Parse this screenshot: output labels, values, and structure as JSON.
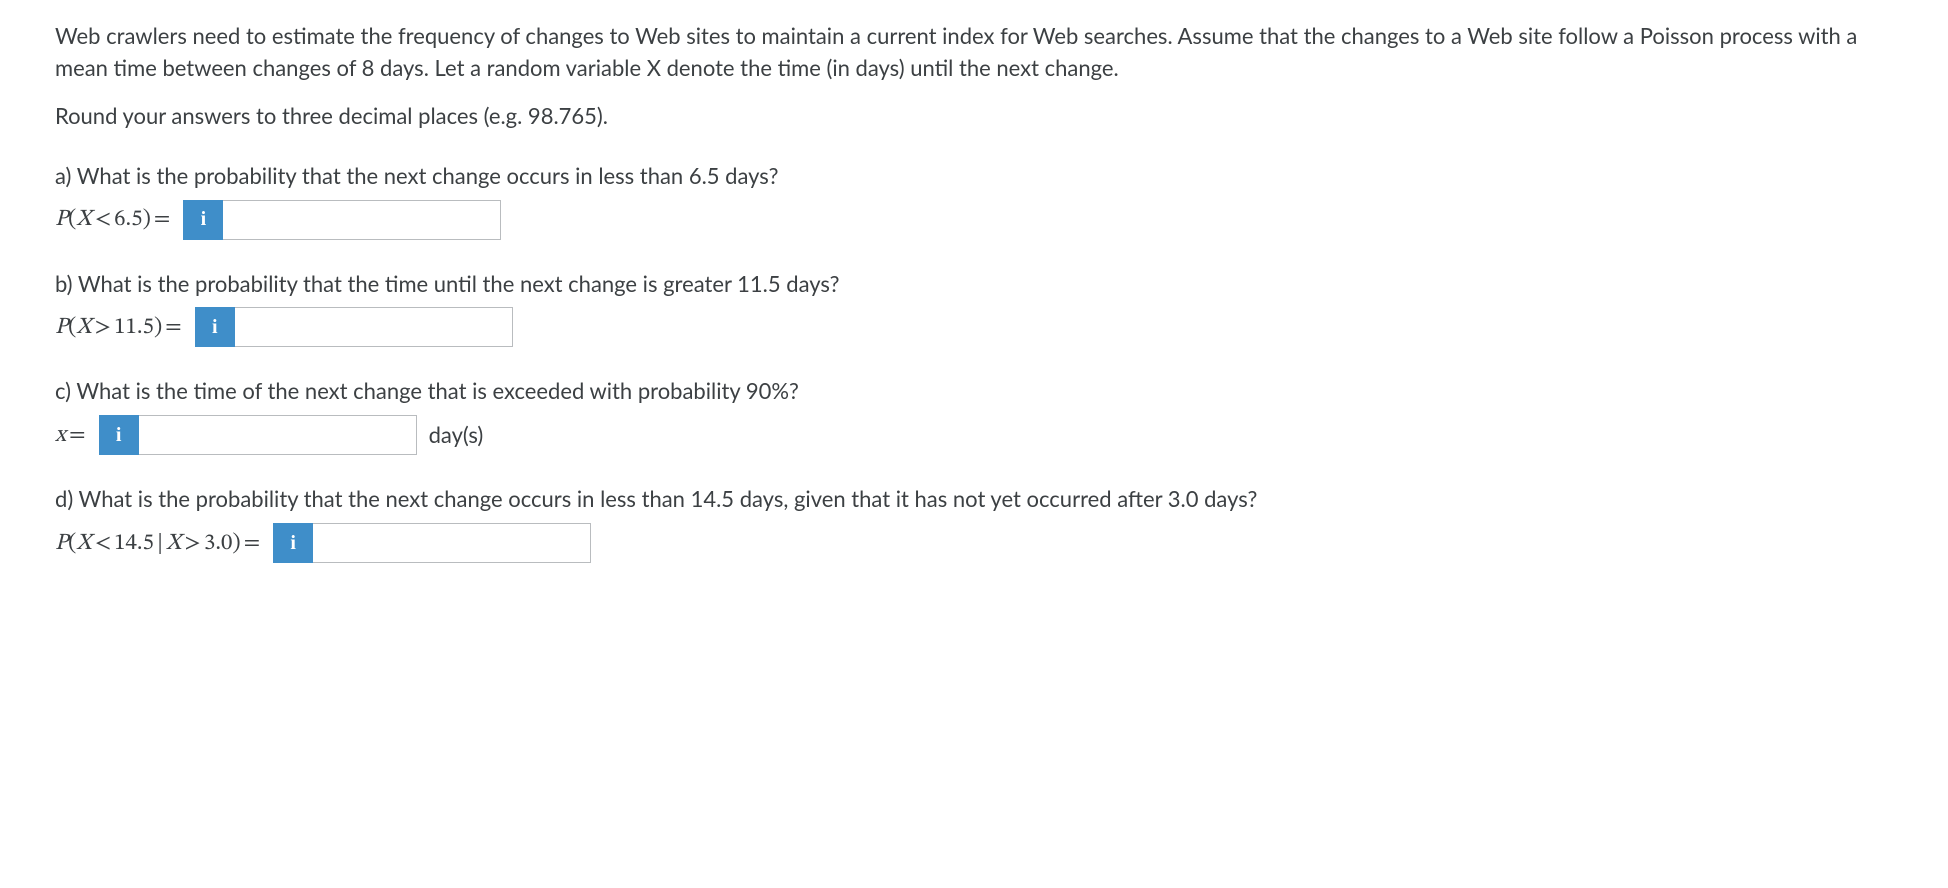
{
  "intro": {
    "p1": "Web crawlers need to estimate the frequency of changes to Web sites to maintain a current index for Web searches. Assume that the changes to a Web site follow a Poisson process with a mean time between changes of 8 days. Let a random variable X denote the time (in days) until the next change.",
    "p2": "Round your answers to three decimal places (e.g. 98.765)."
  },
  "badge_glyph": "i",
  "parts": {
    "a": {
      "question": "a) What is the probability that the next change occurs in less than 6.5 days?",
      "expr_var": "P",
      "expr_inner_var": "X",
      "expr_rel": "<",
      "expr_val": "6.5",
      "eq": "=",
      "value": ""
    },
    "b": {
      "question": "b) What is the probability that the time until the next change is greater 11.5 days?",
      "expr_var": "P",
      "expr_inner_var": "X",
      "expr_rel": ">",
      "expr_val": "11.5",
      "eq": "=",
      "value": ""
    },
    "c": {
      "question": "c) What is the time of the next change that is exceeded with probability 90%?",
      "expr_lhs": "x",
      "eq": "=",
      "value": "",
      "unit": "day(s)"
    },
    "d": {
      "question": "d) What is the probability that the next change occurs in less than 14.5 days, given that it has not yet occurred after 3.0 days?",
      "expr_var": "P",
      "expr_inner_var1": "X",
      "expr_rel1": "<",
      "expr_val1": "14.5",
      "expr_bar": "|",
      "expr_inner_var2": "X",
      "expr_rel2": ">",
      "expr_val2": "3.0",
      "eq": "=",
      "value": ""
    }
  }
}
